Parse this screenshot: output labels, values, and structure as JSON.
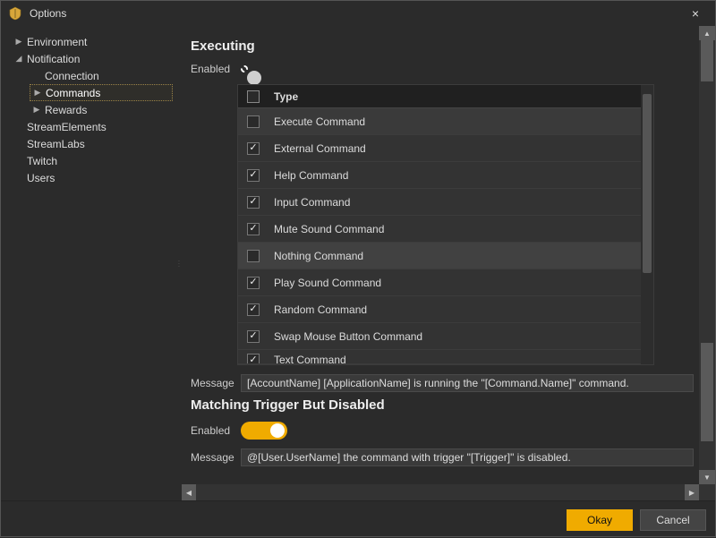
{
  "window": {
    "title": "Options",
    "close_label": "×"
  },
  "sidebar": {
    "items": [
      {
        "label": "Environment",
        "expandable": true,
        "expanded": false
      },
      {
        "label": "Notification",
        "expandable": true,
        "expanded": true,
        "children": [
          {
            "label": "Connection"
          },
          {
            "label": "Commands",
            "expandable": true,
            "expanded": false,
            "selected": true
          },
          {
            "label": "Rewards",
            "expandable": true,
            "expanded": false
          }
        ]
      },
      {
        "label": "StreamElements",
        "expandable": false
      },
      {
        "label": "StreamLabs",
        "expandable": false
      },
      {
        "label": "Twitch",
        "expandable": false
      },
      {
        "label": "Users",
        "expandable": false
      }
    ]
  },
  "content": {
    "executing": {
      "heading": "Executing",
      "enabled_label": "Enabled",
      "enabled_value": false,
      "type_header": "Type",
      "rows": [
        {
          "label": "Execute Command",
          "checked": false
        },
        {
          "label": "External Command",
          "checked": true
        },
        {
          "label": "Help Command",
          "checked": true
        },
        {
          "label": "Input Command",
          "checked": true
        },
        {
          "label": "Mute Sound Command",
          "checked": true
        },
        {
          "label": "Nothing Command",
          "checked": false,
          "hovered": true
        },
        {
          "label": "Play Sound Command",
          "checked": true
        },
        {
          "label": "Random Command",
          "checked": true
        },
        {
          "label": "Swap Mouse Button Command",
          "checked": true
        },
        {
          "label": "Text Command",
          "checked": true,
          "partial": true
        }
      ],
      "message_label": "Message",
      "message_value": "[AccountName] [ApplicationName] is running the \"[Command.Name]\" command."
    },
    "matching": {
      "heading": "Matching Trigger But Disabled",
      "enabled_label": "Enabled",
      "enabled_value": true,
      "message_label": "Message",
      "message_value": "@[User.UserName] the command with trigger \"[Trigger]\" is disabled."
    }
  },
  "footer": {
    "okay_label": "Okay",
    "cancel_label": "Cancel"
  }
}
